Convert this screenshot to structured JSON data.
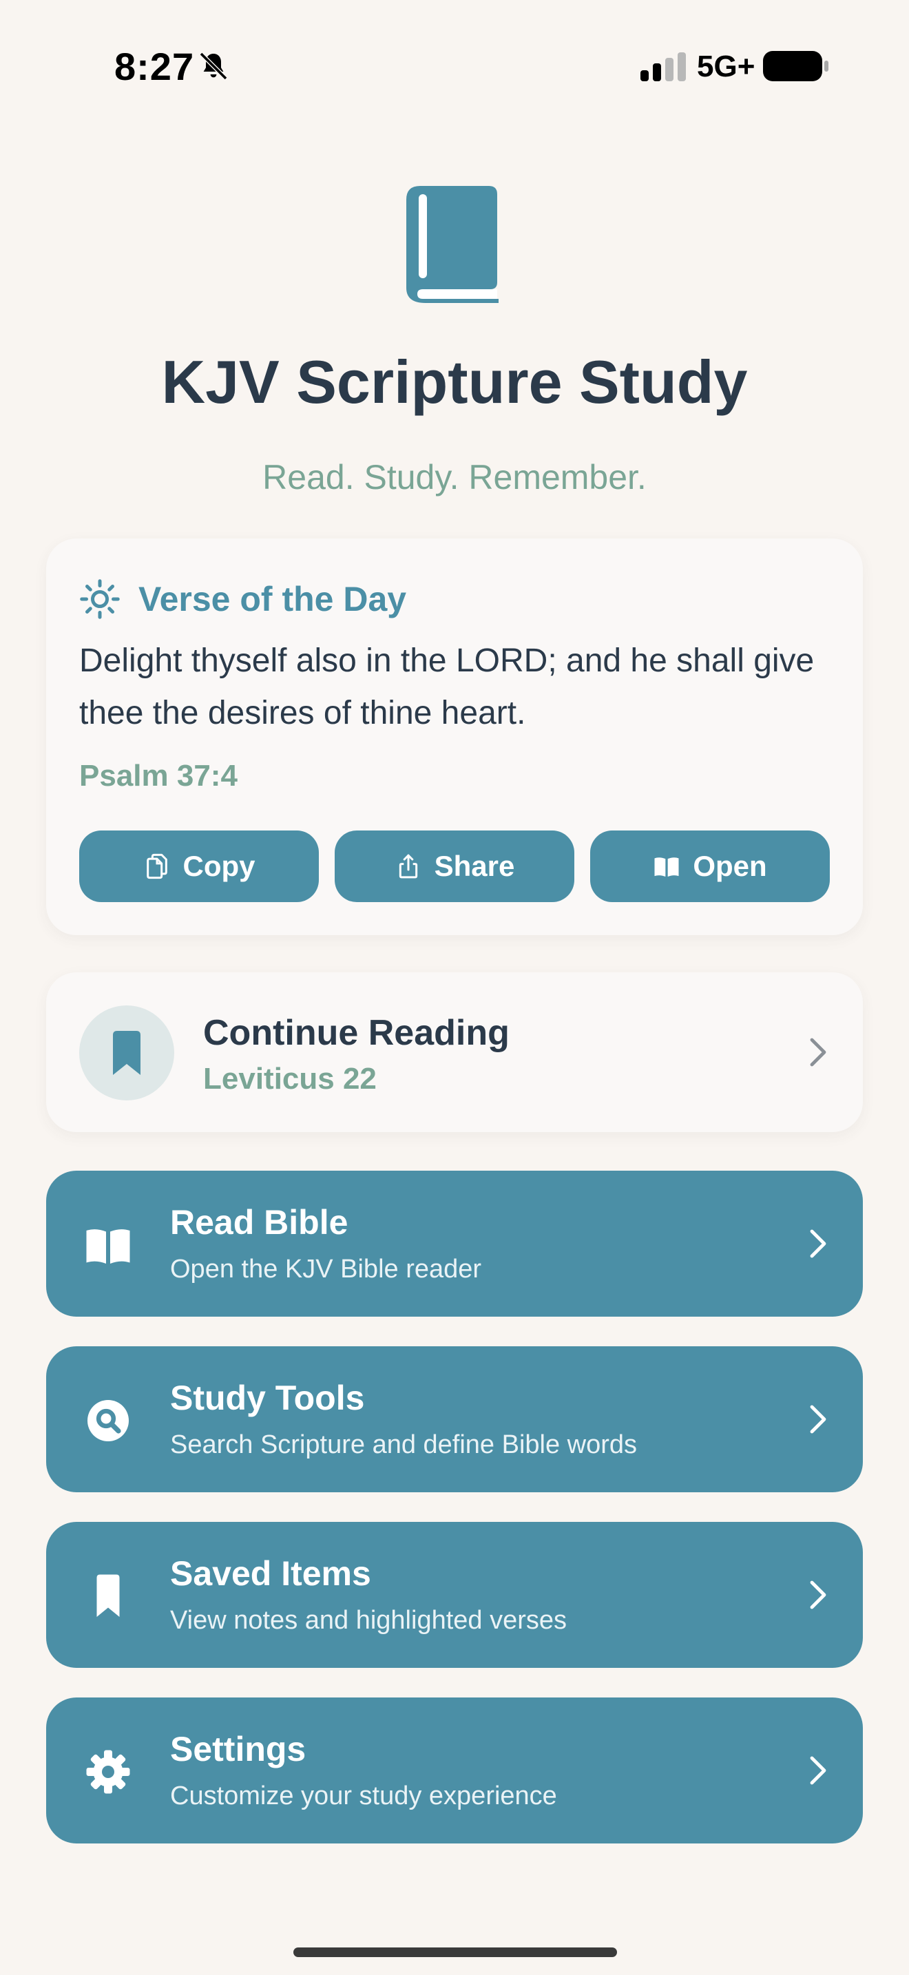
{
  "status": {
    "time": "8:27",
    "network": "5G+"
  },
  "header": {
    "title": "KJV Scripture Study",
    "tagline": "Read. Study. Remember."
  },
  "verse_of_day": {
    "heading": "Verse of the Day",
    "text": "Delight thyself also in the LORD; and he shall give thee the desires of thine heart.",
    "reference": "Psalm 37:4",
    "actions": {
      "copy": "Copy",
      "share": "Share",
      "open": "Open"
    }
  },
  "continue_reading": {
    "title": "Continue Reading",
    "location": "Leviticus 22"
  },
  "menu": [
    {
      "title": "Read Bible",
      "subtitle": "Open the KJV Bible reader",
      "icon": "open-book-icon"
    },
    {
      "title": "Study Tools",
      "subtitle": "Search Scripture and define Bible words",
      "icon": "search-icon"
    },
    {
      "title": "Saved Items",
      "subtitle": "View notes and highlighted verses",
      "icon": "bookmark-icon"
    },
    {
      "title": "Settings",
      "subtitle": "Customize your study experience",
      "icon": "gear-icon"
    }
  ],
  "colors": {
    "accent": "#4b8fa6",
    "sage": "#7aa595",
    "text": "#2b3a4a",
    "background": "#f9f5f1",
    "card": "#faf8f7"
  }
}
